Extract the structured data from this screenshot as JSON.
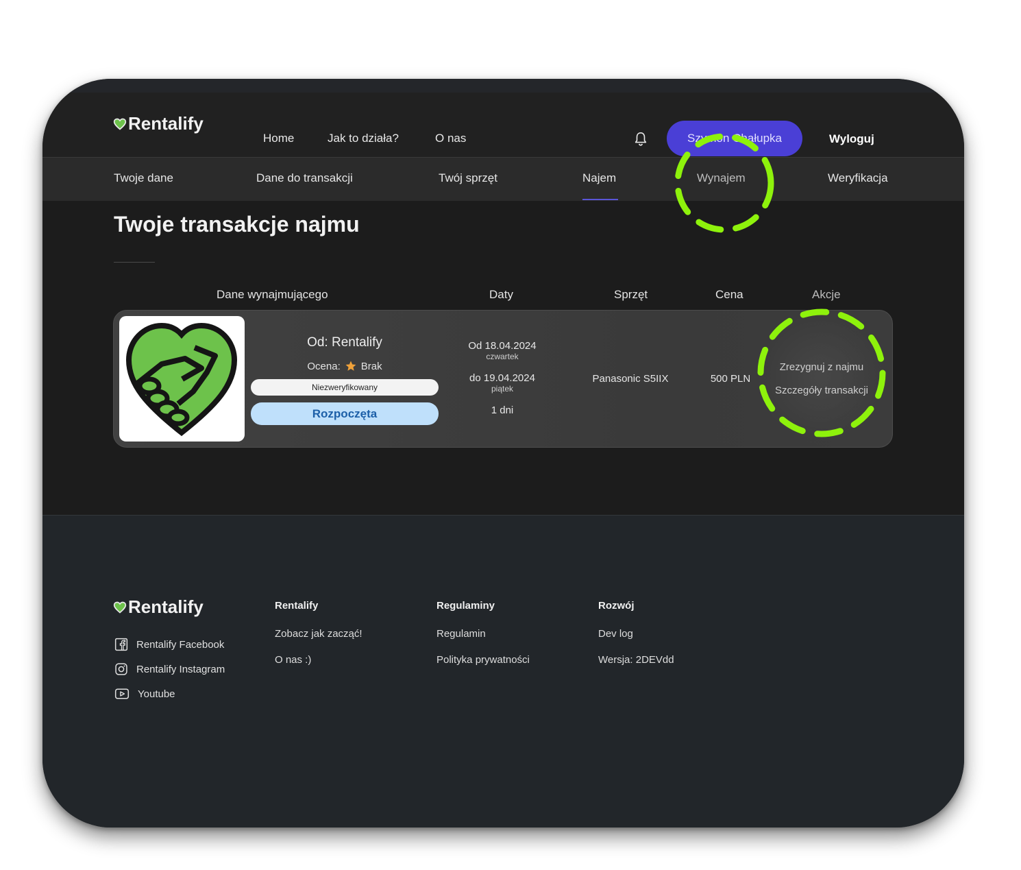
{
  "brand": {
    "name": "Rentalify",
    "accent": "#4a3fd6",
    "logo_green": "#6dc24b"
  },
  "header": {
    "nav": [
      "Home",
      "Jak to działa?",
      "O nas"
    ],
    "user_button": "Szymon Chałupka",
    "logout": "Wyloguj",
    "bell_icon": "bell-icon"
  },
  "tabs": {
    "items": [
      "Twoje dane",
      "Dane do transakcji",
      "Twój sprzęt",
      "Najem",
      "Wynajem",
      "Weryfikacja"
    ],
    "active": "Najem"
  },
  "page": {
    "title": "Twoje transakcje najmu",
    "columns": [
      "Dane wynajmującego",
      "Daty",
      "Sprzęt",
      "Cena",
      "Akcje"
    ]
  },
  "transaction": {
    "owner": "Od: Rentalify",
    "rating_label": "Ocena:",
    "rating_value": "Brak",
    "verification": "Niezweryfikowany",
    "status": "Rozpoczęta",
    "date_from": "Od 18.04.2024",
    "date_from_day": "czwartek",
    "date_to": "do 19.04.2024",
    "date_to_day": "piątek",
    "duration": "1 dni",
    "equipment": "Panasonic S5IIX",
    "price": "500 PLN",
    "actions": {
      "cancel": "Zrezygnuj z najmu",
      "details": "Szczegóły transakcji"
    }
  },
  "footer": {
    "social": [
      {
        "label": "Rentalify Facebook",
        "icon": "facebook-icon"
      },
      {
        "label": "Rentalify Instagram",
        "icon": "instagram-icon"
      },
      {
        "label": "Youtube",
        "icon": "youtube-icon"
      }
    ],
    "columns": [
      {
        "title": "Rentalify",
        "links": [
          "Zobacz jak zacząć!",
          "O nas :)"
        ]
      },
      {
        "title": "Regulaminy",
        "links": [
          "Regulamin",
          "Polityka prywatności"
        ]
      },
      {
        "title": "Rozwój",
        "links": [
          "Dev log",
          "Wersja: 2DEVdd"
        ]
      }
    ]
  },
  "highlight_color": "#8ef20c"
}
